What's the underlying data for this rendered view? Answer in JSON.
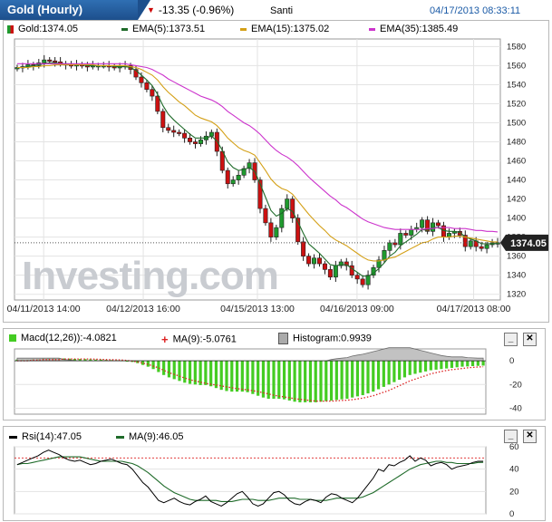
{
  "header": {
    "title": "Gold (Hourly)",
    "change": "-13.35 (-0.96%)",
    "user": "Santi",
    "timestamp": "04/17/2013 08:33:11"
  },
  "main_legend": {
    "gold": "Gold:1374.05",
    "ema5": "EMA(5):1373.51",
    "ema15": "EMA(15):1375.02",
    "ema35": "EMA(35):1385.49"
  },
  "price_label": "1374.05",
  "watermark": "Investing.com",
  "macd_legend": {
    "macd": "Macd(12,26)):-4.0821",
    "ma": "MA(9):-5.0761",
    "hist": "Histogram:0.9939"
  },
  "rsi_legend": {
    "rsi": "Rsi(14):47.05",
    "ma": "MA(9):46.05"
  },
  "buttons": {
    "minimize": "_",
    "close": "✕"
  },
  "colors": {
    "ema5": "#1f6b2a",
    "ema15": "#d4a017",
    "ema35": "#cc33cc",
    "up": "#1f9a2e",
    "down": "#cc1111",
    "macd_hist": "#44cc22",
    "macd_ma": "#dd2222",
    "header": "#1d4f8c"
  },
  "chart_data": [
    {
      "type": "candlestick",
      "title": "Gold (Hourly)",
      "x_ticks": [
        "04/11/2013 14:00",
        "04/12/2013 16:00",
        "04/15/2013 13:00",
        "04/16/2013 09:00",
        "04/17/2013 08:00"
      ],
      "y_ticks": [
        1320,
        1340,
        1360,
        1380,
        1400,
        1420,
        1440,
        1460,
        1480,
        1500,
        1520,
        1540,
        1560,
        1580
      ],
      "ylim": [
        1314,
        1588
      ],
      "last": 1374.05,
      "close": [
        1558,
        1559,
        1561,
        1560,
        1563,
        1566,
        1565,
        1564,
        1562,
        1561,
        1560,
        1561,
        1560,
        1559,
        1560,
        1560,
        1560,
        1559,
        1558,
        1559,
        1560,
        1556,
        1548,
        1542,
        1535,
        1528,
        1512,
        1495,
        1492,
        1490,
        1489,
        1484,
        1480,
        1478,
        1482,
        1486,
        1490,
        1470,
        1450,
        1436,
        1440,
        1445,
        1452,
        1458,
        1440,
        1410,
        1395,
        1380,
        1390,
        1410,
        1420,
        1400,
        1375,
        1360,
        1352,
        1358,
        1352,
        1346,
        1338,
        1350,
        1354,
        1350,
        1340,
        1336,
        1330,
        1340,
        1348,
        1356,
        1366,
        1374,
        1372,
        1384,
        1382,
        1388,
        1390,
        1398,
        1386,
        1395,
        1392,
        1380,
        1384,
        1386,
        1382,
        1370,
        1376,
        1370,
        1368,
        1372,
        1374,
        1374.05
      ],
      "series": [
        {
          "name": "EMA(5)",
          "values": [
            1558,
            1558,
            1559,
            1560,
            1561,
            1562,
            1563,
            1563,
            1562,
            1562,
            1561,
            1561,
            1561,
            1560,
            1560,
            1560,
            1560,
            1560,
            1559,
            1559,
            1559,
            1558,
            1555,
            1550,
            1545,
            1539,
            1530,
            1518,
            1509,
            1503,
            1498,
            1493,
            1488,
            1484,
            1484,
            1484,
            1486,
            1481,
            1471,
            1459,
            1453,
            1450,
            1451,
            1453,
            1449,
            1436,
            1422,
            1408,
            1402,
            1405,
            1410,
            1407,
            1396,
            1384,
            1373,
            1368,
            1363,
            1357,
            1351,
            1350,
            1351,
            1351,
            1347,
            1343,
            1339,
            1339,
            1342,
            1347,
            1353,
            1360,
            1364,
            1371,
            1375,
            1379,
            1383,
            1388,
            1387,
            1390,
            1390,
            1387,
            1386,
            1386,
            1385,
            1380,
            1378,
            1376,
            1373,
            1373,
            1373,
            1373.51
          ]
        },
        {
          "name": "EMA(15)",
          "values": [
            1558,
            1558,
            1558,
            1559,
            1559,
            1560,
            1560,
            1561,
            1561,
            1561,
            1561,
            1561,
            1561,
            1561,
            1561,
            1560,
            1560,
            1560,
            1560,
            1560,
            1560,
            1559,
            1558,
            1556,
            1553,
            1550,
            1545,
            1538,
            1532,
            1527,
            1522,
            1518,
            1513,
            1508,
            1505,
            1503,
            1501,
            1497,
            1491,
            1484,
            1479,
            1474,
            1471,
            1469,
            1466,
            1458,
            1450,
            1441,
            1435,
            1431,
            1429,
            1425,
            1418,
            1411,
            1404,
            1398,
            1392,
            1387,
            1381,
            1377,
            1374,
            1371,
            1367,
            1363,
            1359,
            1356,
            1355,
            1355,
            1356,
            1358,
            1359,
            1362,
            1365,
            1368,
            1371,
            1374,
            1375,
            1378,
            1380,
            1380,
            1380,
            1381,
            1381,
            1380,
            1379,
            1378,
            1377,
            1376,
            1375,
            1375.02
          ]
        },
        {
          "name": "EMA(35)",
          "values": [
            1562,
            1562,
            1562,
            1562,
            1562,
            1562,
            1562,
            1562,
            1562,
            1562,
            1562,
            1562,
            1562,
            1562,
            1562,
            1562,
            1562,
            1562,
            1562,
            1562,
            1562,
            1561,
            1560,
            1559,
            1558,
            1556,
            1553,
            1550,
            1546,
            1543,
            1540,
            1537,
            1534,
            1531,
            1528,
            1526,
            1524,
            1521,
            1517,
            1512,
            1508,
            1504,
            1500,
            1497,
            1493,
            1488,
            1482,
            1476,
            1471,
            1467,
            1464,
            1460,
            1455,
            1449,
            1443,
            1438,
            1433,
            1428,
            1423,
            1419,
            1414,
            1411,
            1407,
            1403,
            1399,
            1396,
            1394,
            1392,
            1390,
            1389,
            1388,
            1388,
            1388,
            1388,
            1388,
            1388,
            1389,
            1389,
            1390,
            1390,
            1390,
            1389,
            1389,
            1389,
            1388,
            1387,
            1387,
            1386,
            1386,
            1385.49
          ]
        }
      ]
    },
    {
      "type": "bar",
      "title": "Macd(12,26)",
      "y_ticks": [
        0,
        -20,
        -40
      ],
      "ylim": [
        -45,
        10
      ],
      "series": [
        {
          "name": "Macd(12,26)",
          "values": [
            1,
            1,
            1,
            1.5,
            1.5,
            2,
            2,
            2,
            2,
            2,
            1.8,
            1.6,
            1.5,
            1.4,
            1.2,
            1,
            1,
            0.8,
            0.6,
            0.5,
            0.4,
            0,
            -1,
            -2,
            -3.5,
            -5,
            -7,
            -9.5,
            -12,
            -14,
            -15.5,
            -17,
            -18.5,
            -19.5,
            -20,
            -20.5,
            -20.5,
            -21.5,
            -23,
            -24.5,
            -25.5,
            -26,
            -26,
            -26,
            -26.5,
            -28,
            -29.5,
            -31,
            -32,
            -32,
            -32,
            -32.5,
            -33.5,
            -34.5,
            -35,
            -35,
            -35,
            -35,
            -34.5,
            -34,
            -33.5,
            -33,
            -32.5,
            -32,
            -31,
            -30,
            -29,
            -27.5,
            -26,
            -24,
            -22,
            -20,
            -18,
            -16,
            -14,
            -12,
            -11,
            -10,
            -9,
            -8,
            -7.5,
            -7,
            -6.5,
            -6,
            -5.5,
            -5,
            -4.8,
            -4.5,
            -4.3,
            -4.0821
          ]
        },
        {
          "name": "MA(9)",
          "values": [
            0,
            0,
            0,
            0.5,
            0.5,
            1,
            1,
            1,
            1,
            1.5,
            1.5,
            1.5,
            1.5,
            1.5,
            1.5,
            1.3,
            1.2,
            1,
            0.9,
            0.8,
            0.6,
            0.3,
            -0.3,
            -1,
            -2,
            -3,
            -4.5,
            -6,
            -8,
            -10,
            -11.5,
            -13,
            -14.5,
            -16,
            -17,
            -18,
            -19,
            -19.8,
            -20.5,
            -21.2,
            -22,
            -22.8,
            -23.5,
            -24,
            -24.5,
            -25.2,
            -26,
            -27,
            -28,
            -29,
            -29.8,
            -30.5,
            -31.2,
            -32,
            -32.5,
            -33,
            -33.5,
            -34,
            -34,
            -34,
            -34,
            -33.8,
            -33.5,
            -33.2,
            -32.8,
            -32.2,
            -31.5,
            -30.5,
            -29.5,
            -28,
            -26.5,
            -25,
            -23,
            -21,
            -19,
            -17,
            -15.5,
            -14,
            -12.5,
            -11,
            -10,
            -9,
            -8.2,
            -7.5,
            -7,
            -6.5,
            -6,
            -5.6,
            -5.3,
            -5.0761
          ]
        },
        {
          "name": "Histogram",
          "values": [
            1,
            1,
            1,
            1,
            1,
            1,
            1,
            1,
            1,
            0.5,
            0.3,
            0.1,
            0,
            -0.1,
            -0.3,
            -0.3,
            -0.2,
            -0.2,
            -0.3,
            -0.3,
            -0.2,
            -0.3,
            -0.7,
            -1,
            -1.5,
            -2,
            -2.5,
            -3.5,
            -4,
            -4,
            -4,
            -4,
            -4,
            -3.5,
            -3,
            -2.5,
            -1.5,
            -1.7,
            -2.5,
            -3.3,
            -3.5,
            -3.2,
            -2.5,
            -2,
            -2,
            -2.8,
            -3.5,
            -4,
            -4,
            -3,
            -2.2,
            -2,
            -2.3,
            -2.5,
            -2.5,
            -2,
            -1.5,
            -1,
            -0.5,
            0,
            0.5,
            0.8,
            1,
            1.2,
            1.8,
            2.2,
            2.5,
            3,
            3.5,
            4,
            4.5,
            5,
            5,
            5,
            5,
            5,
            4.5,
            4,
            3.5,
            3,
            2.5,
            2,
            1.7,
            1.5,
            1.5,
            1.5,
            1.2,
            1.1,
            1,
            0.9939
          ]
        }
      ]
    },
    {
      "type": "line",
      "title": "Rsi(14)",
      "y_ticks": [
        0,
        20,
        40,
        60
      ],
      "ylim": [
        0,
        60
      ],
      "series": [
        {
          "name": "Rsi(14)",
          "values": [
            44,
            46,
            48,
            50,
            52,
            55,
            57,
            55,
            53,
            50,
            48,
            47,
            48,
            46,
            44,
            45,
            47,
            48,
            49,
            47,
            45,
            44,
            40,
            34,
            28,
            24,
            18,
            12,
            10,
            12,
            14,
            11,
            9,
            8,
            11,
            13,
            16,
            11,
            9,
            7,
            10,
            14,
            18,
            20,
            15,
            9,
            7,
            9,
            14,
            19,
            20,
            17,
            12,
            9,
            8,
            11,
            13,
            12,
            10,
            15,
            18,
            17,
            14,
            12,
            10,
            14,
            20,
            26,
            32,
            40,
            38,
            44,
            43,
            46,
            48,
            52,
            47,
            50,
            48,
            43,
            45,
            46,
            44,
            40,
            42,
            43,
            44,
            46,
            47,
            47.05
          ]
        },
        {
          "name": "MA(9)",
          "values": [
            44,
            45,
            45,
            46,
            47,
            48,
            49,
            50,
            51,
            51,
            51,
            51,
            51,
            50,
            49,
            48,
            47,
            47,
            47,
            47,
            47,
            46,
            45,
            43,
            40,
            37,
            33,
            29,
            25,
            22,
            19,
            17,
            15,
            13,
            12,
            12,
            12,
            12,
            12,
            11,
            11,
            11,
            12,
            13,
            13,
            13,
            12,
            12,
            12,
            13,
            14,
            14,
            14,
            14,
            13,
            13,
            13,
            12,
            12,
            12,
            13,
            14,
            14,
            14,
            14,
            14,
            15,
            17,
            19,
            22,
            25,
            28,
            31,
            34,
            37,
            40,
            42,
            44,
            45,
            46,
            47,
            47,
            46,
            46,
            45,
            45,
            45,
            45,
            46,
            46.05
          ]
        }
      ]
    }
  ]
}
